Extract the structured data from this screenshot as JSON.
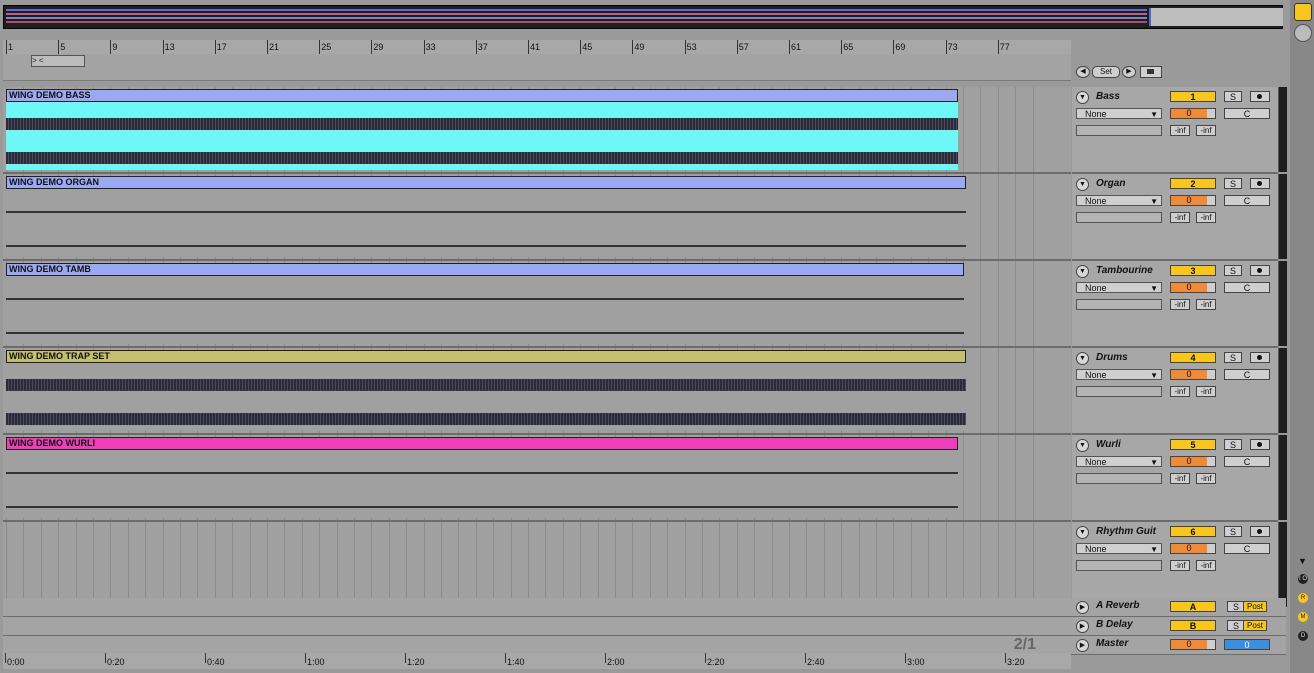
{
  "arrangement": {
    "bar_ruler": [
      "1",
      "5",
      "9",
      "13",
      "17",
      "21",
      "25",
      "29",
      "33",
      "37",
      "41",
      "45",
      "49",
      "53",
      "57",
      "61",
      "65",
      "69",
      "73",
      "77"
    ],
    "time_ruler": [
      "0:00",
      "0:20",
      "0:40",
      "1:00",
      "1:20",
      "1:40",
      "2:00",
      "2:20",
      "2:40",
      "3:00",
      "3:20"
    ],
    "loop_brace": "> <",
    "zoom_indicator": "2/1",
    "transport": {
      "set_label": "Set",
      "prev_icon": "◀",
      "next_icon": "▶"
    }
  },
  "tracks": [
    {
      "clip_name": "WING DEMO BASS",
      "clip_color": "#6ff7f7",
      "head_color": "#9aa9f2",
      "name": "Bass",
      "number": "1",
      "input": "None",
      "volume": "0",
      "pan": "C",
      "solo": "S",
      "inf_left": "-inf",
      "inf_right": "-inf"
    },
    {
      "clip_name": "WING DEMO ORGAN",
      "clip_color": "#a0a0a0",
      "head_color": "#9aa9f2",
      "name": "Organ",
      "number": "2",
      "input": "None",
      "volume": "0",
      "pan": "C",
      "solo": "S",
      "inf_left": "-inf",
      "inf_right": "-inf"
    },
    {
      "clip_name": "WING DEMO TAMB",
      "clip_color": "#a0a0a0",
      "head_color": "#9aa9f2",
      "name": "Tambourine",
      "number": "3",
      "input": "None",
      "volume": "0",
      "pan": "C",
      "solo": "S",
      "inf_left": "-inf",
      "inf_right": "-inf"
    },
    {
      "clip_name": "WING DEMO TRAP SET",
      "clip_color": "#a0a0a0",
      "head_color": "#c3bf6e",
      "name": "Drums",
      "number": "4",
      "input": "None",
      "volume": "0",
      "pan": "C",
      "solo": "S",
      "inf_left": "-inf",
      "inf_right": "-inf"
    },
    {
      "clip_name": "WING DEMO WURLI",
      "clip_color": "#a0a0a0",
      "head_color": "#ef3fb8",
      "name": "Wurli",
      "number": "5",
      "input": "None",
      "volume": "0",
      "pan": "C",
      "solo": "S",
      "inf_left": "-inf",
      "inf_right": "-inf"
    },
    {
      "clip_name": "",
      "clip_color": "",
      "head_color": "",
      "name": "Rhythm Guit",
      "number": "6",
      "input": "None",
      "volume": "0",
      "pan": "C",
      "solo": "S",
      "inf_left": "-inf",
      "inf_right": "-inf"
    }
  ],
  "returns": [
    {
      "name": "A Reverb",
      "letter": "A",
      "solo": "S",
      "post": "Post"
    },
    {
      "name": "B Delay",
      "letter": "B",
      "solo": "S",
      "post": "Post"
    }
  ],
  "master": {
    "name": "Master",
    "volume": "0",
    "cue": "0"
  },
  "side_buttons": [
    "I O",
    "R",
    "M",
    "D"
  ]
}
